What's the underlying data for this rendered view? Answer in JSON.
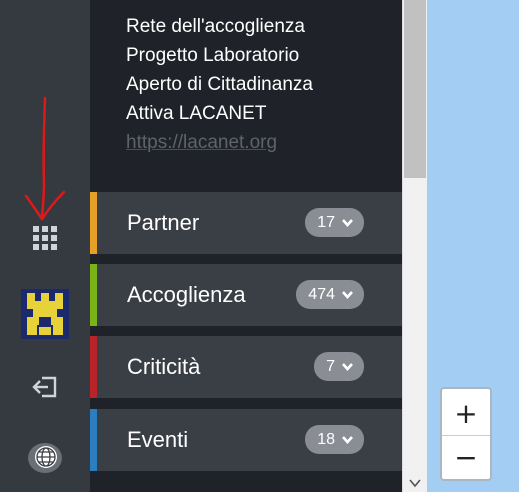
{
  "sidebar": {
    "icons": [
      "apps-grid-icon",
      "avatar-icon",
      "logout-icon",
      "globe-icon"
    ]
  },
  "description": {
    "lines": [
      "Rete dell'accoglienza",
      "Progetto Laboratorio",
      "Aperto di Cittadinanza",
      "Attiva LACANET"
    ],
    "link": "https://lacanet.org"
  },
  "categories": [
    {
      "label": "Partner",
      "count": "17",
      "color": "#e69f27"
    },
    {
      "label": "Accoglienza",
      "count": "474",
      "color": "#7ab317"
    },
    {
      "label": "Criticità",
      "count": "7",
      "color": "#b8242a"
    },
    {
      "label": "Eventi",
      "count": "18",
      "color": "#2b7fc1"
    }
  ],
  "map": {
    "zoom_in_label": "+",
    "zoom_out_label": "−"
  },
  "colors": {
    "rail_bg": "#353a40",
    "panel_bg": "#1f2329",
    "row_bg": "#3a3f46",
    "badge_bg": "#8a8e94",
    "map_bg": "#a3cdf2",
    "annotation": "#e01818"
  }
}
